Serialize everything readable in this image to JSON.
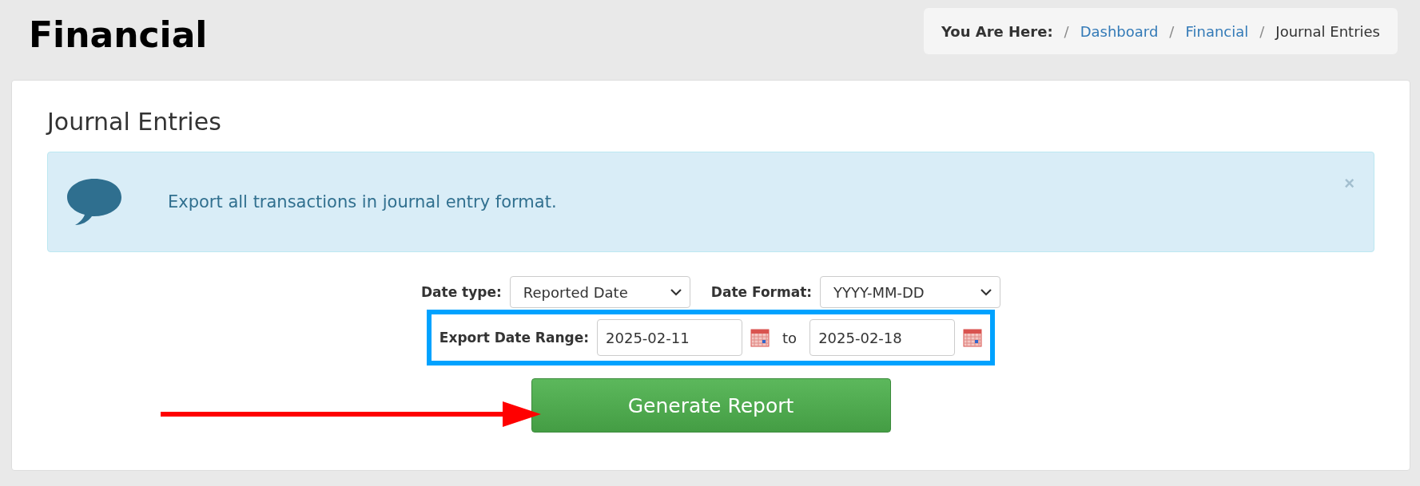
{
  "page_title": "Financial",
  "breadcrumb": [
    {
      "kind": "label",
      "text": "You Are Here:"
    },
    {
      "kind": "separator",
      "text": "/"
    },
    {
      "kind": "link",
      "text": "Dashboard"
    },
    {
      "kind": "separator",
      "text": "/"
    },
    {
      "kind": "link",
      "text": "Financial"
    },
    {
      "kind": "separator",
      "text": "/"
    },
    {
      "kind": "current",
      "text": "Journal Entries"
    }
  ],
  "card": {
    "title": "Journal Entries",
    "alert": {
      "message": "Export all transactions in journal entry format.",
      "close": "×"
    },
    "date_type": {
      "label": "Date type:",
      "value": "Reported Date"
    },
    "date_format": {
      "label": "Date Format:",
      "value": "YYYY-MM-DD"
    },
    "date_range": {
      "label": "Export Date Range:",
      "from": "2025-02-11",
      "joiner": "to",
      "to": "2025-02-18",
      "highlighted": true
    },
    "generate_button": "Generate Report",
    "pointer_arrow": true
  }
}
